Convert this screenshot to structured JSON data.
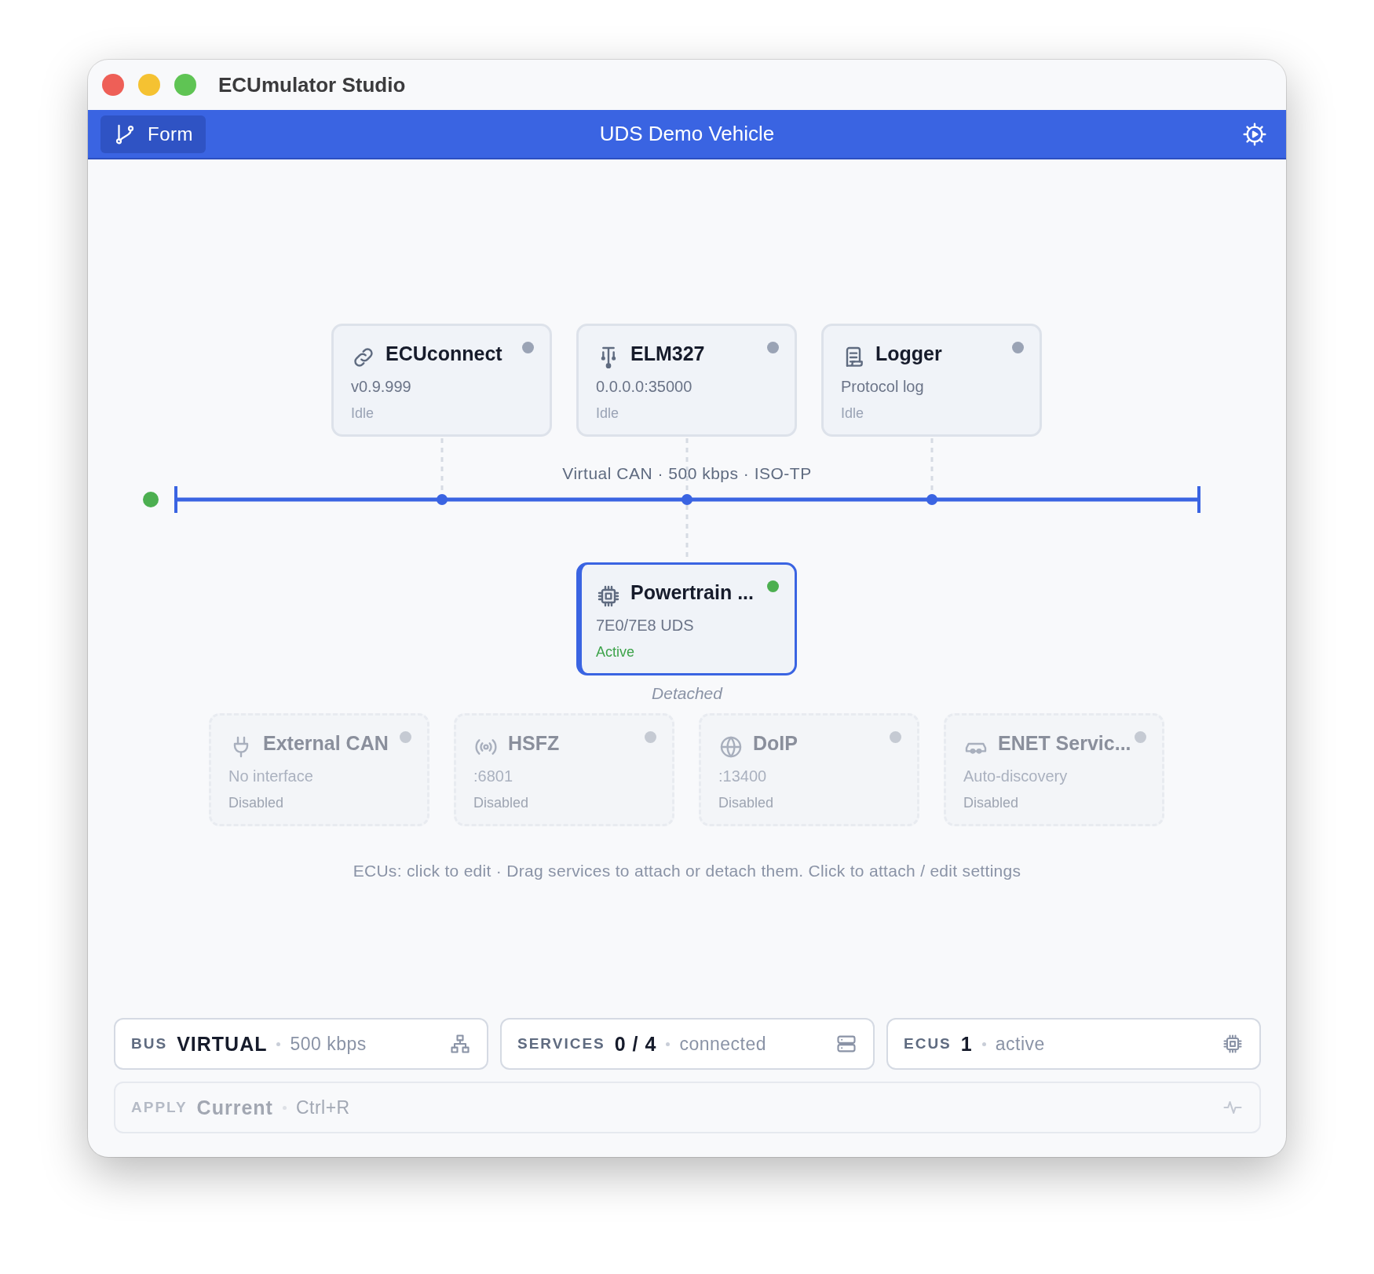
{
  "window": {
    "title": "ECUmulator Studio"
  },
  "header": {
    "form_button": "Form",
    "title": "UDS Demo Vehicle"
  },
  "interfaces": [
    {
      "name": "ECUconnect",
      "detail": "v0.9.999",
      "status": "Idle",
      "color": "#9aa3b5",
      "attached": true
    },
    {
      "name": "ELM327",
      "detail": "0.0.0.0:35000",
      "status": "Idle",
      "color": "#9aa3b5",
      "attached": true
    },
    {
      "name": "Logger",
      "detail": "Protocol log",
      "status": "Idle",
      "color": "#9aa3b5",
      "attached": true
    }
  ],
  "bus": {
    "label": "Virtual CAN · 500 kbps · ISO-TP",
    "online": true
  },
  "ecus": [
    {
      "name": "Powertrain ...",
      "detail": "7E0/7E8 UDS",
      "status": "Active",
      "color": "#4caf50",
      "active": true,
      "selected": true
    }
  ],
  "services_caption": "Detached",
  "services": [
    {
      "name": "External CAN",
      "detail": "No interface",
      "status": "Disabled",
      "color": "#c5cad3",
      "disabled": true
    },
    {
      "name": "HSFZ",
      "detail": ":6801",
      "status": "Disabled",
      "color": "#c5cad3",
      "disabled": true
    },
    {
      "name": "DoIP",
      "detail": ":13400",
      "status": "Disabled",
      "color": "#c5cad3",
      "disabled": true
    },
    {
      "name": "ENET Servic...",
      "detail": "Auto-discovery",
      "status": "Disabled",
      "color": "#c5cad3",
      "disabled": true
    }
  ],
  "hint": "ECUs: click to edit · Drag services to attach or detach them. Click to attach / edit settings",
  "stats": [
    {
      "label": "BUS",
      "value": "VIRTUAL",
      "detail": "500 kbps",
      "disabled": false
    },
    {
      "label": "SERVICES",
      "value": "0 / 4",
      "detail": "connected",
      "disabled": false
    },
    {
      "label": "ECUS",
      "value": "1",
      "detail": "active",
      "disabled": false
    }
  ],
  "apply": {
    "label": "APPLY",
    "value": "Current",
    "detail": "Ctrl+R",
    "disabled": true
  }
}
